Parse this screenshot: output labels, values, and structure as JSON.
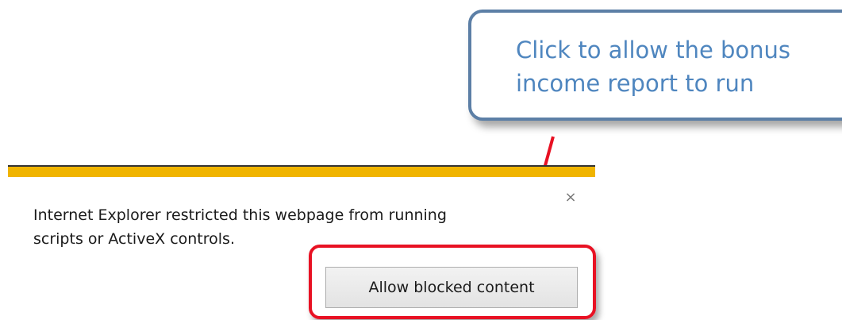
{
  "callout": {
    "text_line1": "Click to allow the bonus",
    "text_line2": "income report to run"
  },
  "notification": {
    "message_line1": "Internet Explorer restricted this webpage from running",
    "message_line2": "scripts or ActiveX controls.",
    "close_glyph": "×",
    "allow_button_label": "Allow blocked content"
  },
  "colors": {
    "callout_border": "#5c7fa6",
    "callout_text": "#4f86bf",
    "stripe": "#f0b400",
    "highlight": "#e81123",
    "arrow": "#e81123"
  }
}
